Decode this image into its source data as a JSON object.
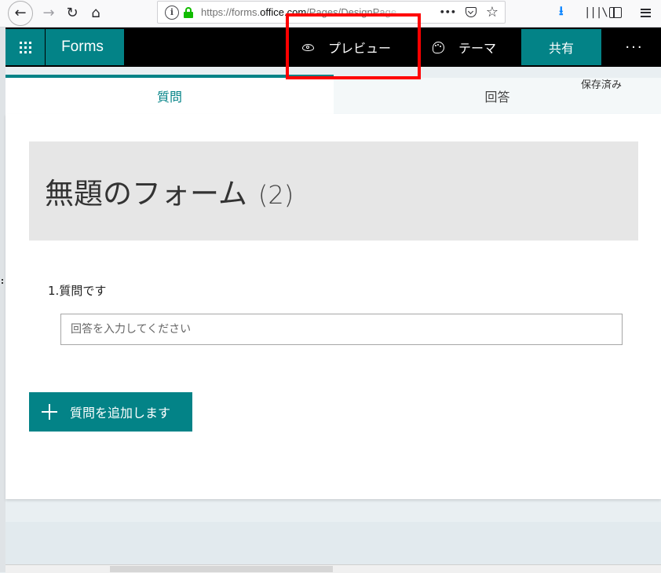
{
  "browser": {
    "url_prefix": "https://forms.",
    "url_domain": "office.com",
    "url_path": "/Pages/DesignPage",
    "icons": {
      "back": "←",
      "forward": "→",
      "reload": "↻",
      "home": "⌂",
      "info": "i",
      "more": "•••",
      "star": "☆",
      "download": "⭳",
      "library": "|||\\"
    }
  },
  "header": {
    "app_name": "Forms",
    "preview_label": "プレビュー",
    "theme_label": "テーマ",
    "share_label": "共有",
    "more_label": "···",
    "accent_color": "#038387"
  },
  "tabs": {
    "questions": "質問",
    "responses": "回答",
    "saved_status": "保存済み"
  },
  "form": {
    "title": "無題のフォーム",
    "title_suffix": "(2)",
    "question_number": "1.",
    "question_text": "質問です",
    "answer_placeholder": "回答を入力してください",
    "add_question_label": "質問を追加します"
  }
}
